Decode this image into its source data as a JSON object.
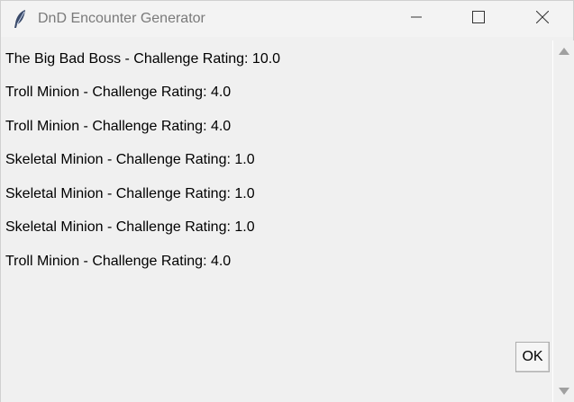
{
  "window": {
    "title": "DnD Encounter Generator",
    "icon": "feather-icon"
  },
  "controls": {
    "minimize_icon": "minimize-icon",
    "maximize_icon": "maximize-icon",
    "close_icon": "close-icon"
  },
  "encounter": {
    "lines": [
      "The Big Bad Boss - Challenge Rating: 10.0",
      "Troll Minion - Challenge Rating: 4.0",
      "Troll Minion - Challenge Rating: 4.0",
      "Skeletal Minion - Challenge Rating: 1.0",
      "Skeletal Minion - Challenge Rating: 1.0",
      "Skeletal Minion - Challenge Rating: 1.0",
      "Troll Minion - Challenge Rating: 4.0"
    ]
  },
  "buttons": {
    "ok_label": "OK"
  }
}
